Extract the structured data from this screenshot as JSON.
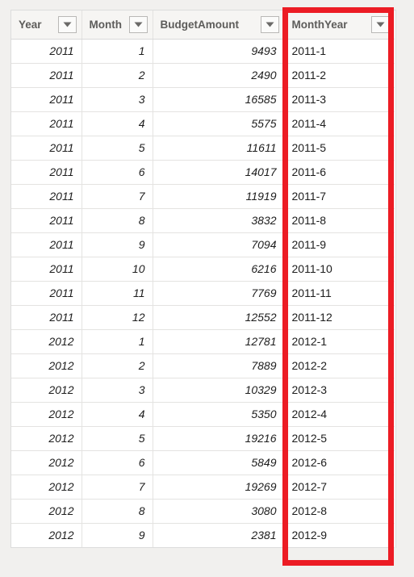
{
  "grid": {
    "columns": [
      {
        "label": "Year",
        "align": "num",
        "filter_icon": "chevron-down-icon"
      },
      {
        "label": "Month",
        "align": "num",
        "filter_icon": "chevron-down-icon"
      },
      {
        "label": "BudgetAmount",
        "align": "num",
        "filter_icon": "chevron-down-icon"
      },
      {
        "label": "MonthYear",
        "align": "txt",
        "filter_icon": "chevron-down-icon"
      }
    ],
    "rows": [
      [
        "2011",
        "1",
        "9493",
        "2011-1"
      ],
      [
        "2011",
        "2",
        "2490",
        "2011-2"
      ],
      [
        "2011",
        "3",
        "16585",
        "2011-3"
      ],
      [
        "2011",
        "4",
        "5575",
        "2011-4"
      ],
      [
        "2011",
        "5",
        "11611",
        "2011-5"
      ],
      [
        "2011",
        "6",
        "14017",
        "2011-6"
      ],
      [
        "2011",
        "7",
        "11919",
        "2011-7"
      ],
      [
        "2011",
        "8",
        "3832",
        "2011-8"
      ],
      [
        "2011",
        "9",
        "7094",
        "2011-9"
      ],
      [
        "2011",
        "10",
        "6216",
        "2011-10"
      ],
      [
        "2011",
        "11",
        "7769",
        "2011-11"
      ],
      [
        "2011",
        "12",
        "12552",
        "2011-12"
      ],
      [
        "2012",
        "1",
        "12781",
        "2012-1"
      ],
      [
        "2012",
        "2",
        "7889",
        "2012-2"
      ],
      [
        "2012",
        "3",
        "10329",
        "2012-3"
      ],
      [
        "2012",
        "4",
        "5350",
        "2012-4"
      ],
      [
        "2012",
        "5",
        "19216",
        "2012-5"
      ],
      [
        "2012",
        "6",
        "5849",
        "2012-6"
      ],
      [
        "2012",
        "7",
        "19269",
        "2012-7"
      ],
      [
        "2012",
        "8",
        "3080",
        "2012-8"
      ],
      [
        "2012",
        "9",
        "2381",
        "2012-9"
      ]
    ]
  },
  "annotation": {
    "highlight_color": "#ec1c24",
    "highlighted_column": "MonthYear"
  },
  "colors": {
    "page_background": "#f1f0ee",
    "header_background": "#f6f5f3",
    "header_text": "#5d5c5a",
    "cell_text": "#1d1d1d",
    "grid_line": "#e4e3e1"
  }
}
